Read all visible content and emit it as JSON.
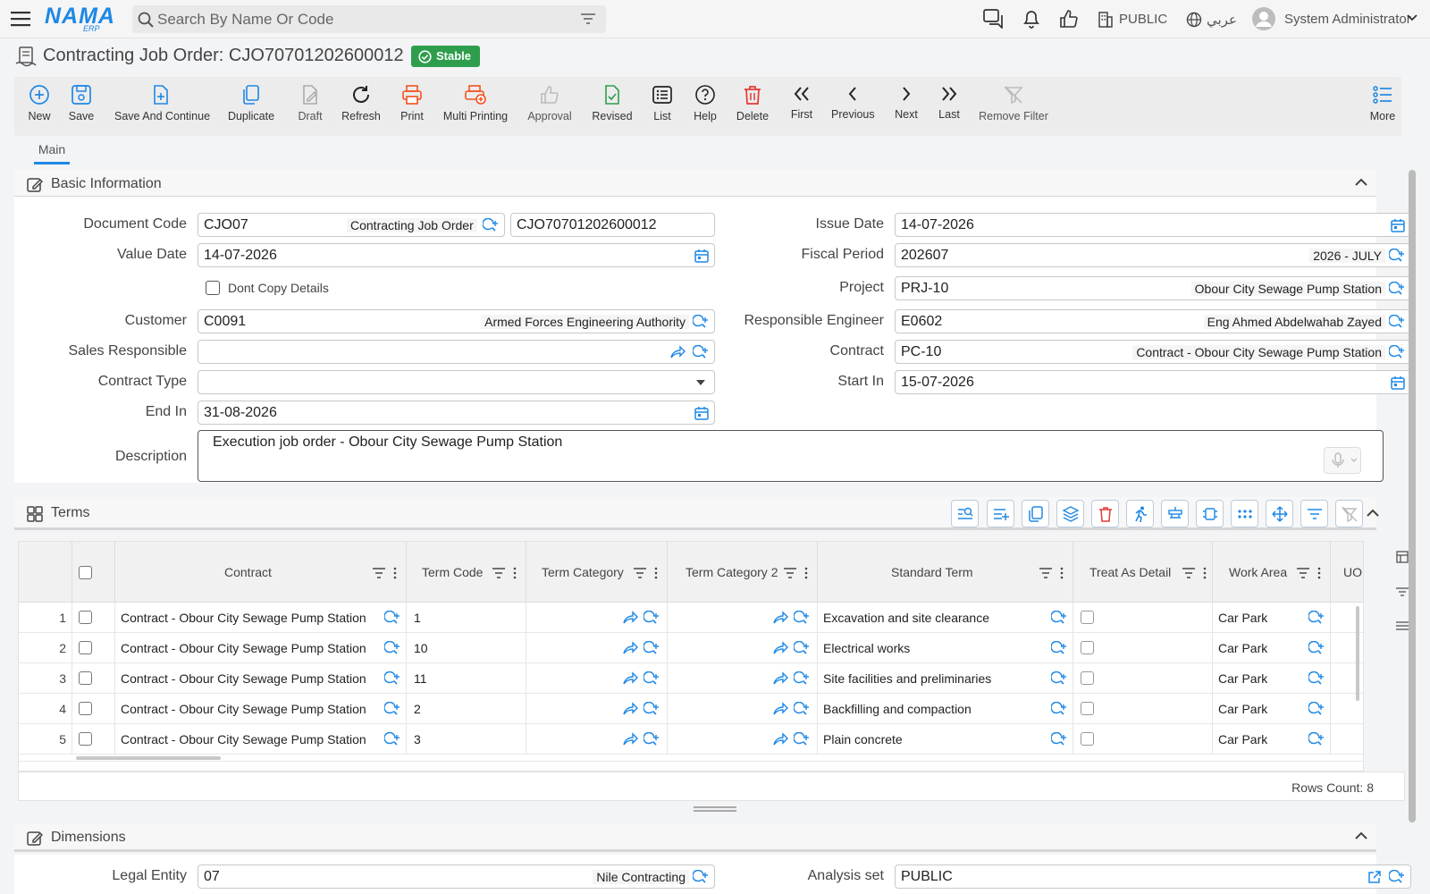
{
  "topbar": {
    "logo_main": "NAMA",
    "logo_sub": "ERP",
    "search_placeholder": "Search By Name Or Code",
    "company": "PUBLIC",
    "language": "عربي",
    "user": "System Administrator"
  },
  "page": {
    "title": "Contracting Job Order: CJO70701202600012",
    "status": "Stable",
    "tab": "Main"
  },
  "toolbar": {
    "new": "New",
    "save": "Save",
    "save_continue": "Save And Continue",
    "duplicate": "Duplicate",
    "draft": "Draft",
    "refresh": "Refresh",
    "print": "Print",
    "multi_printing": "Multi Printing",
    "approval": "Approval",
    "revised": "Revised",
    "list": "List",
    "help": "Help",
    "delete": "Delete",
    "first": "First",
    "previous": "Previous",
    "next": "Next",
    "last": "Last",
    "remove_filter": "Remove Filter",
    "more": "More"
  },
  "basic": {
    "header": "Basic Information",
    "document_code_label": "Document Code",
    "document_code": "CJO07",
    "document_type": "Contracting Job Order",
    "document_number": "CJO70701202600012",
    "value_date_label": "Value Date",
    "value_date": "14-07-2026",
    "dont_copy_label": "Dont Copy Details",
    "customer_label": "Customer",
    "customer_code": "C0091",
    "customer_name": "Armed Forces Engineering Authority",
    "sales_label": "Sales Responsible",
    "contract_type_label": "Contract Type",
    "end_in_label": "End In",
    "end_in": "31-08-2026",
    "issue_date_label": "Issue Date",
    "issue_date": "14-07-2026",
    "fiscal_label": "Fiscal Period",
    "fiscal_code": "202607",
    "fiscal_name": "2026 - JULY",
    "project_label": "Project",
    "project_code": "PRJ-10",
    "project_name": "Obour City Sewage Pump Station",
    "engineer_label": "Responsible Engineer",
    "engineer_code": "E0602",
    "engineer_name": "Eng Ahmed Abdelwahab Zayed",
    "contract_label": "Contract",
    "contract_code": "PC-10",
    "contract_name": "Contract - Obour City Sewage Pump Station",
    "start_in_label": "Start In",
    "start_in": "15-07-2026",
    "description_label": "Description",
    "description": "Execution job order - Obour City Sewage Pump Station"
  },
  "terms": {
    "header": "Terms",
    "columns": [
      "Contract",
      "Term Code",
      "Term Category",
      "Term Category 2",
      "Standard Term",
      "Treat As Detail",
      "Work Area",
      "UOI"
    ],
    "rows": [
      {
        "n": "1",
        "contract": "Contract - Obour City Sewage Pump Station",
        "code": "1",
        "standard": "Excavation and site clearance",
        "area": "Car Park"
      },
      {
        "n": "2",
        "contract": "Contract - Obour City Sewage Pump Station",
        "code": "10",
        "standard": "Electrical works",
        "area": "Car Park"
      },
      {
        "n": "3",
        "contract": "Contract - Obour City Sewage Pump Station",
        "code": "11",
        "standard": "Site facilities and preliminaries",
        "area": "Car Park"
      },
      {
        "n": "4",
        "contract": "Contract - Obour City Sewage Pump Station",
        "code": "2",
        "standard": "Backfilling and compaction",
        "area": "Car Park"
      },
      {
        "n": "5",
        "contract": "Contract - Obour City Sewage Pump Station",
        "code": "3",
        "standard": "Plain concrete",
        "area": "Car Park"
      }
    ],
    "rows_count": "Rows Count: 8"
  },
  "dimensions": {
    "header": "Dimensions",
    "legal_entity_label": "Legal Entity",
    "legal_entity_code": "07",
    "legal_entity_name": "Nile Contracting",
    "analysis_label": "Analysis set",
    "analysis_value": "PUBLIC"
  },
  "colors": {
    "accent": "#1e88e5",
    "stable": "#2e9e4d",
    "danger": "#e53935",
    "print": "#f4511e"
  }
}
